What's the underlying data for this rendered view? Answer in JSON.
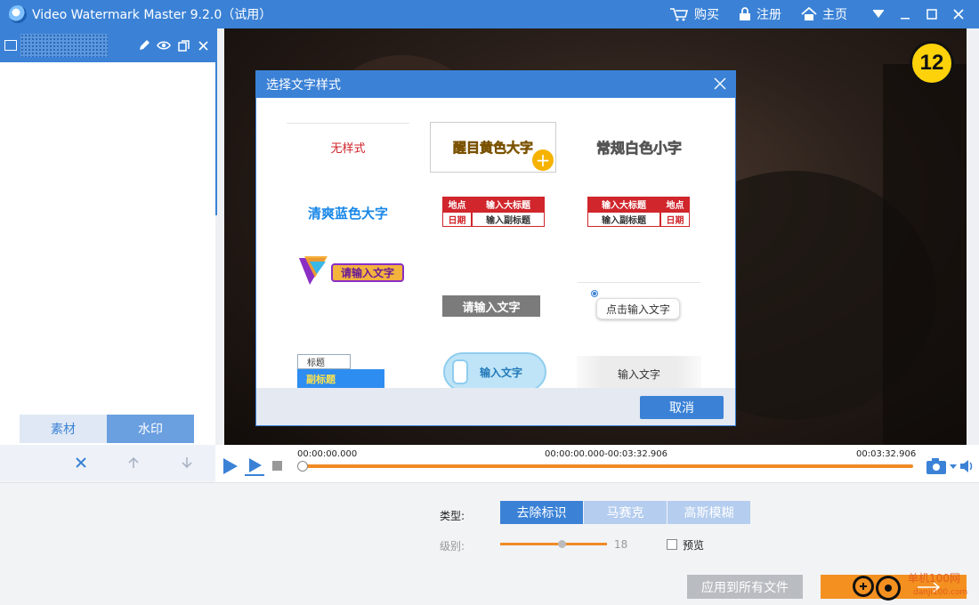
{
  "titlebar": {
    "app_title": "Video Watermark Master 9.2.0（试用）",
    "buy": "购买",
    "register": "注册",
    "home": "主页"
  },
  "left": {
    "tabs": [
      "素材",
      "水印"
    ],
    "active_tab": "水印"
  },
  "video": {
    "badge": "12"
  },
  "modal": {
    "title": "选择文字样式",
    "cancel": "取消",
    "styles": {
      "none": "无样式",
      "yellow_big": "醒目黄色大字",
      "white_small": "常规白色小字",
      "blue_big": "清爽蓝色大字",
      "location": "地点",
      "date": "日期",
      "enter_title": "输入大标题",
      "enter_subtitle": "输入副标题",
      "please_enter": "请输入文字",
      "gray_enter": "请输入文字",
      "click_enter": "点击输入文字",
      "title": "标题",
      "subtitle": "副标题",
      "cloud_enter": "输入文字",
      "brush_enter": "输入文字"
    }
  },
  "playback": {
    "time_start": "00:00:00.000",
    "time_range": "00:00:00.000-00:03:32.906",
    "time_end": "00:03:32.906"
  },
  "settings": {
    "type_label": "类型:",
    "types": [
      "去除标识",
      "马赛克",
      "高斯模糊"
    ],
    "level_label": "级别:",
    "level_value": "18",
    "level_fraction": 0.58,
    "preview_label": "预览",
    "apply_all": "应用到所有文件",
    "site_watermark": "单机100网",
    "site_url": "danji100.com"
  },
  "colors": {
    "accent": "#3b82d6",
    "orange": "#f08a24"
  }
}
